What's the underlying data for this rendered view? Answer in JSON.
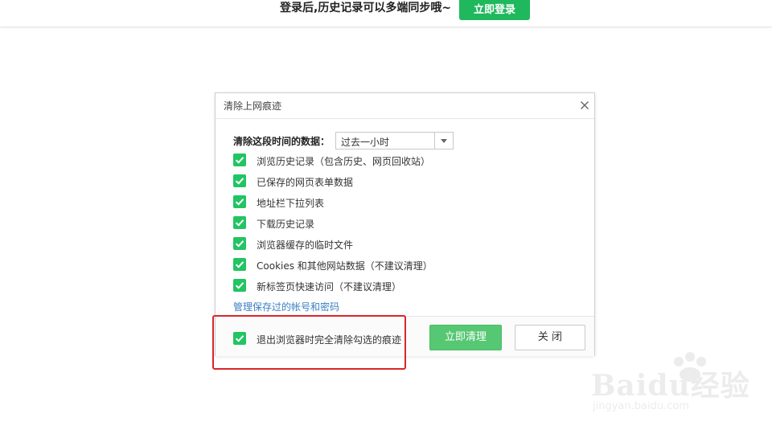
{
  "topbar": {
    "message": "登录后,历史记录可以多端同步哦~",
    "login_label": "立即登录"
  },
  "dialog": {
    "title": "清除上网痕迹",
    "close_icon": "close-icon",
    "range_label": "清除这段时间的数据：",
    "range_value": "过去一小时",
    "options": [
      {
        "label": "浏览历史记录（包含历史、网页回收站）",
        "checked": true
      },
      {
        "label": "已保存的网页表单数据",
        "checked": true
      },
      {
        "label": "地址栏下拉列表",
        "checked": true
      },
      {
        "label": "下载历史记录",
        "checked": true
      },
      {
        "label": "浏览器缓存的临时文件",
        "checked": true
      },
      {
        "label": "Cookies 和其他网站数据（不建议清理）",
        "checked": true
      },
      {
        "label": "新标签页快速访问（不建议清理）",
        "checked": true
      }
    ],
    "manage_link": "管理保存过的帐号和密码",
    "exit_option": {
      "label": "退出浏览器时完全清除勾选的痕迹",
      "checked": true
    },
    "clear_label": "立即清理",
    "close_label": "关 闭"
  },
  "watermark": {
    "text": "Baidu经验",
    "sub": "jingyan.baidu.com"
  },
  "colors": {
    "accent": "#22c463",
    "highlight": "#d9262a",
    "link": "#3a7fc1"
  }
}
